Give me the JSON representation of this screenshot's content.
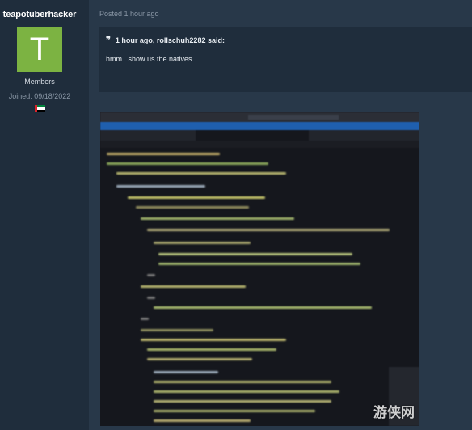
{
  "user": {
    "name": "teapotuberhacker",
    "avatar_letter": "T",
    "avatar_color": "#7cb342",
    "role": "Members",
    "joined": "Joined: 09/18/2022",
    "flag_icon": "uae-flag-icon"
  },
  "post": {
    "posted": "Posted 1 hour ago",
    "quote": {
      "icon": "quote-icon",
      "header": "1 hour ago, rollschuh2282 said:",
      "body": "hmm...show us the natives."
    },
    "attachment": {
      "description_icon": "blurred-code-editor-screenshot"
    }
  },
  "watermark": "游侠网",
  "colors": {
    "page_bg": "#253445",
    "sidebar_bg": "#1f2d3c",
    "quote_bg": "#1f2d3c",
    "accent_blue": "#1f5fae"
  }
}
